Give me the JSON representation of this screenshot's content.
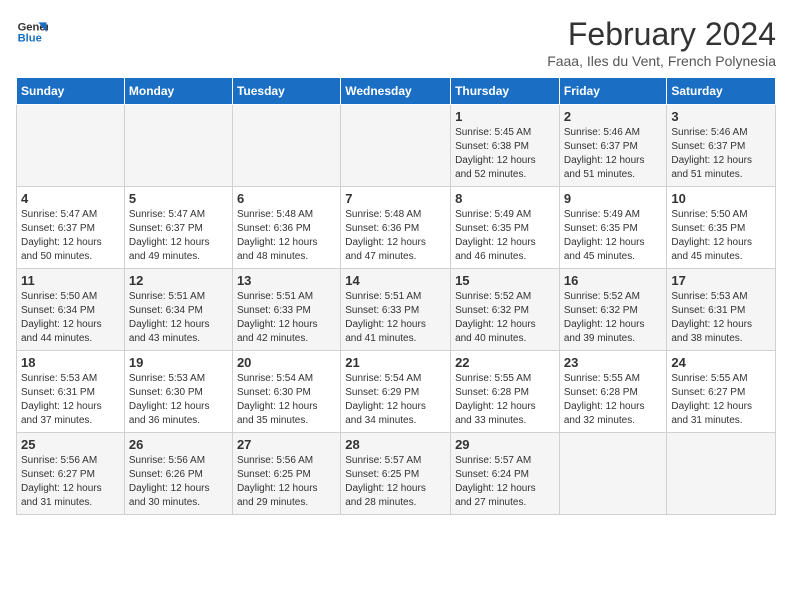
{
  "logo": {
    "line1": "General",
    "line2": "Blue"
  },
  "title": "February 2024",
  "subtitle": "Faaa, Iles du Vent, French Polynesia",
  "weekdays": [
    "Sunday",
    "Monday",
    "Tuesday",
    "Wednesday",
    "Thursday",
    "Friday",
    "Saturday"
  ],
  "rows": [
    [
      {
        "day": "",
        "info": ""
      },
      {
        "day": "",
        "info": ""
      },
      {
        "day": "",
        "info": ""
      },
      {
        "day": "",
        "info": ""
      },
      {
        "day": "1",
        "info": "Sunrise: 5:45 AM\nSunset: 6:38 PM\nDaylight: 12 hours\nand 52 minutes."
      },
      {
        "day": "2",
        "info": "Sunrise: 5:46 AM\nSunset: 6:37 PM\nDaylight: 12 hours\nand 51 minutes."
      },
      {
        "day": "3",
        "info": "Sunrise: 5:46 AM\nSunset: 6:37 PM\nDaylight: 12 hours\nand 51 minutes."
      }
    ],
    [
      {
        "day": "4",
        "info": "Sunrise: 5:47 AM\nSunset: 6:37 PM\nDaylight: 12 hours\nand 50 minutes."
      },
      {
        "day": "5",
        "info": "Sunrise: 5:47 AM\nSunset: 6:37 PM\nDaylight: 12 hours\nand 49 minutes."
      },
      {
        "day": "6",
        "info": "Sunrise: 5:48 AM\nSunset: 6:36 PM\nDaylight: 12 hours\nand 48 minutes."
      },
      {
        "day": "7",
        "info": "Sunrise: 5:48 AM\nSunset: 6:36 PM\nDaylight: 12 hours\nand 47 minutes."
      },
      {
        "day": "8",
        "info": "Sunrise: 5:49 AM\nSunset: 6:35 PM\nDaylight: 12 hours\nand 46 minutes."
      },
      {
        "day": "9",
        "info": "Sunrise: 5:49 AM\nSunset: 6:35 PM\nDaylight: 12 hours\nand 45 minutes."
      },
      {
        "day": "10",
        "info": "Sunrise: 5:50 AM\nSunset: 6:35 PM\nDaylight: 12 hours\nand 45 minutes."
      }
    ],
    [
      {
        "day": "11",
        "info": "Sunrise: 5:50 AM\nSunset: 6:34 PM\nDaylight: 12 hours\nand 44 minutes."
      },
      {
        "day": "12",
        "info": "Sunrise: 5:51 AM\nSunset: 6:34 PM\nDaylight: 12 hours\nand 43 minutes."
      },
      {
        "day": "13",
        "info": "Sunrise: 5:51 AM\nSunset: 6:33 PM\nDaylight: 12 hours\nand 42 minutes."
      },
      {
        "day": "14",
        "info": "Sunrise: 5:51 AM\nSunset: 6:33 PM\nDaylight: 12 hours\nand 41 minutes."
      },
      {
        "day": "15",
        "info": "Sunrise: 5:52 AM\nSunset: 6:32 PM\nDaylight: 12 hours\nand 40 minutes."
      },
      {
        "day": "16",
        "info": "Sunrise: 5:52 AM\nSunset: 6:32 PM\nDaylight: 12 hours\nand 39 minutes."
      },
      {
        "day": "17",
        "info": "Sunrise: 5:53 AM\nSunset: 6:31 PM\nDaylight: 12 hours\nand 38 minutes."
      }
    ],
    [
      {
        "day": "18",
        "info": "Sunrise: 5:53 AM\nSunset: 6:31 PM\nDaylight: 12 hours\nand 37 minutes."
      },
      {
        "day": "19",
        "info": "Sunrise: 5:53 AM\nSunset: 6:30 PM\nDaylight: 12 hours\nand 36 minutes."
      },
      {
        "day": "20",
        "info": "Sunrise: 5:54 AM\nSunset: 6:30 PM\nDaylight: 12 hours\nand 35 minutes."
      },
      {
        "day": "21",
        "info": "Sunrise: 5:54 AM\nSunset: 6:29 PM\nDaylight: 12 hours\nand 34 minutes."
      },
      {
        "day": "22",
        "info": "Sunrise: 5:55 AM\nSunset: 6:28 PM\nDaylight: 12 hours\nand 33 minutes."
      },
      {
        "day": "23",
        "info": "Sunrise: 5:55 AM\nSunset: 6:28 PM\nDaylight: 12 hours\nand 32 minutes."
      },
      {
        "day": "24",
        "info": "Sunrise: 5:55 AM\nSunset: 6:27 PM\nDaylight: 12 hours\nand 31 minutes."
      }
    ],
    [
      {
        "day": "25",
        "info": "Sunrise: 5:56 AM\nSunset: 6:27 PM\nDaylight: 12 hours\nand 31 minutes."
      },
      {
        "day": "26",
        "info": "Sunrise: 5:56 AM\nSunset: 6:26 PM\nDaylight: 12 hours\nand 30 minutes."
      },
      {
        "day": "27",
        "info": "Sunrise: 5:56 AM\nSunset: 6:25 PM\nDaylight: 12 hours\nand 29 minutes."
      },
      {
        "day": "28",
        "info": "Sunrise: 5:57 AM\nSunset: 6:25 PM\nDaylight: 12 hours\nand 28 minutes."
      },
      {
        "day": "29",
        "info": "Sunrise: 5:57 AM\nSunset: 6:24 PM\nDaylight: 12 hours\nand 27 minutes."
      },
      {
        "day": "",
        "info": ""
      },
      {
        "day": "",
        "info": ""
      }
    ]
  ]
}
